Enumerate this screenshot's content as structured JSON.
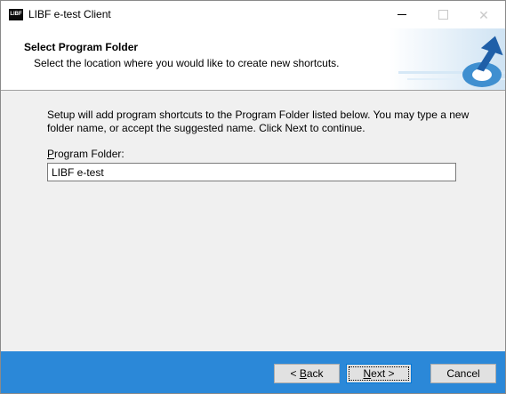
{
  "window": {
    "title": "LIBF e-test Client",
    "icon_text": "LIBF"
  },
  "header": {
    "title": "Select Program Folder",
    "subtitle": "Select the location where you would like to create new shortcuts."
  },
  "body": {
    "instructions": "Setup will add program shortcuts to the Program Folder listed below. You may type a new folder name, or accept the suggested name. Click Next to continue.",
    "folder_label_first": "P",
    "folder_label_rest": "rogram Folder:",
    "folder_value": "LIBF e-test"
  },
  "footer": {
    "back_pre": "< ",
    "back_u": "B",
    "back_rest": "ack",
    "next_u": "N",
    "next_rest": "ext >",
    "cancel": "Cancel"
  },
  "colors": {
    "footer": "#2b88d8",
    "dialog_bg": "#f0f0f0",
    "focus_border": "#0078d7"
  }
}
